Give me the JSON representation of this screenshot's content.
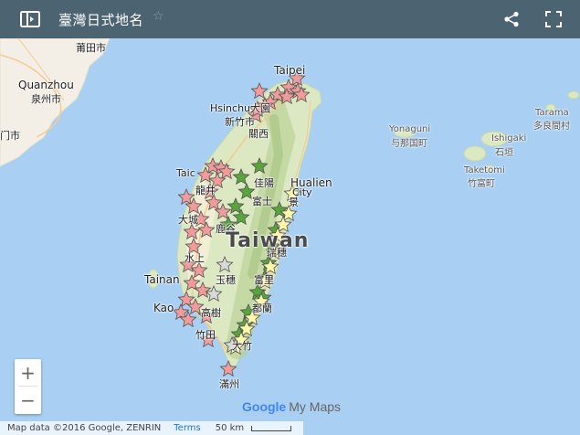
{
  "header": {
    "title": "臺灣日式地名",
    "share_icon": "share-icon",
    "fullscreen_icon": "fullscreen-icon",
    "panel_icon": "sidebar-toggle-icon",
    "star_icon": "star-icon"
  },
  "map": {
    "place_labels": {
      "putian": "莆田市",
      "quanzhou": "Quanzhou",
      "quanzhou_zh": "泉州市",
      "xiamen": "门市",
      "taipei": "Taipei",
      "hsinchu": "Hsinchu",
      "hsinchu_zh": "新竹市",
      "daxi": "大園",
      "guanxi": "關西",
      "hualien": "Hualien",
      "hualien_city": "City",
      "jiayang": "佳陽",
      "longjing": "龍井",
      "fushi": "富士",
      "dacheng": "大城",
      "lugu": "鹿谷",
      "taiwan": "Taiwan",
      "shuishang": "水上",
      "yushan": "玉穗",
      "fuli": "富里",
      "tainan": "Tainan",
      "kaohsiung": "Kao",
      "gaoshu": "高樹",
      "dulan": "都蘭",
      "zhutian": "竹田",
      "dazhu": "大竹",
      "manzhou": "滿州",
      "jing": "景",
      "ruisui": "瑞穗",
      "yonaguni": "Yonaguni",
      "yonaguni_zh": "与那国町",
      "ishigaki": "Ishigaki",
      "ishigaki_zh": "石垣",
      "taketomi": "Taketomi",
      "taketomi_zh": "竹富町",
      "tarama": "Tarama",
      "tarama_zh": "多良間村",
      "taichung_partial": "Taic"
    }
  },
  "zoom": {
    "in": "+",
    "out": "−"
  },
  "branding": {
    "google": "Google",
    "mymaps": "My Maps"
  },
  "attribution": {
    "text": "Map data ©2016 Google, ZENRIN",
    "terms": "Terms",
    "scale": "50 km"
  },
  "colors": {
    "header_bg": "#4c6471",
    "sea": "#a9d0f3",
    "marker_pink": "#f19b9b",
    "marker_green": "#57a53b",
    "marker_yellow": "#fff7a8",
    "marker_grey": "#d9d9d9"
  }
}
